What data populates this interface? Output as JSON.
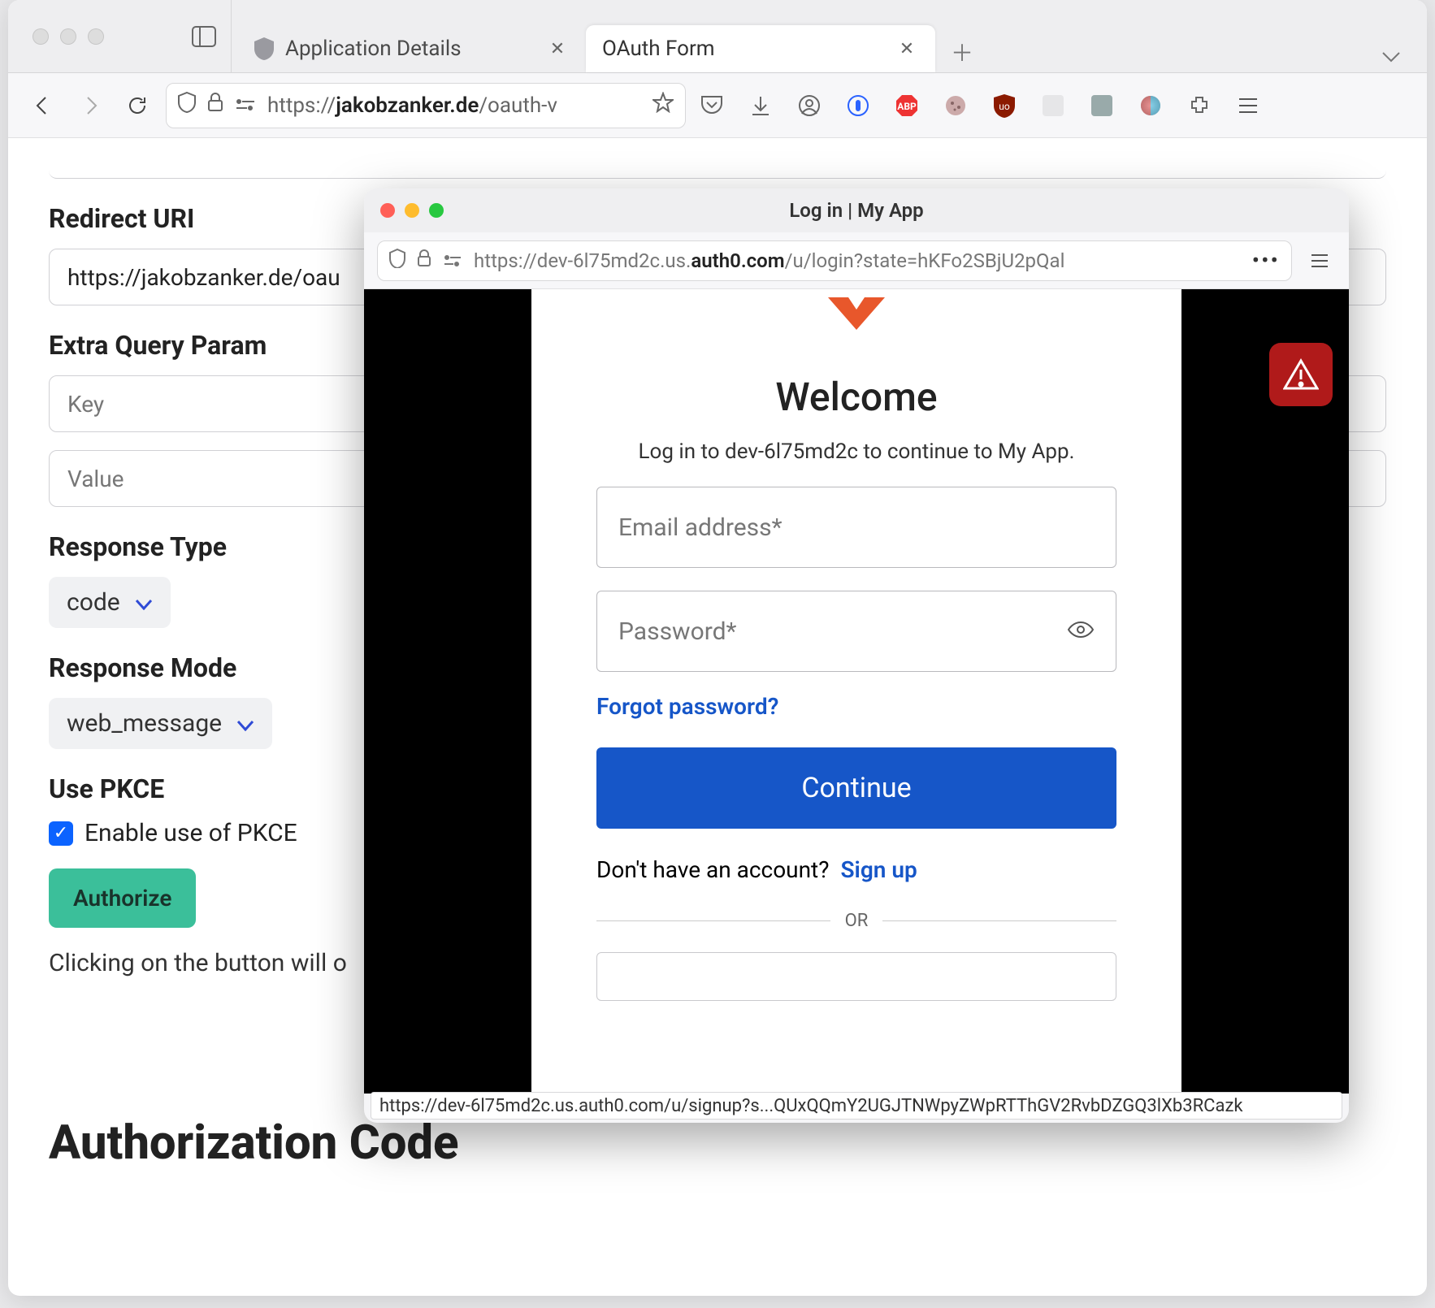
{
  "main_browser": {
    "tabs": [
      {
        "title": "Application Details",
        "active": false
      },
      {
        "title": "OAuth Form",
        "active": true
      }
    ],
    "url_prefix": "https://",
    "url_host": "jakobzanker.de",
    "url_path": "/oauth-v",
    "page": {
      "redirect_uri_label": "Redirect URI",
      "redirect_uri_value": "https://jakobzanker.de/oau",
      "extra_param_label": "Extra Query Param",
      "extra_key_placeholder": "Key",
      "extra_value_placeholder": "Value",
      "response_type_label": "Response Type",
      "response_type_value": "code",
      "response_mode_label": "Response Mode",
      "response_mode_value": "web_message",
      "use_pkce_label": "Use PKCE",
      "pkce_checkbox_label": "Enable use of PKCE",
      "pkce_checked": true,
      "authorize_button": "Authorize",
      "authorize_hint": "Clicking on the button will o",
      "auth_code_heading": "Authorization Code"
    }
  },
  "popup": {
    "title": "Log in | My App",
    "url_prefix": "https://dev-6l75md2c.us.",
    "url_host": "auth0.com",
    "url_path": "/u/login?state=hKFo2SBjU2pQal",
    "welcome": "Welcome",
    "subtitle": "Log in to dev-6l75md2c to continue to My App.",
    "email_placeholder": "Email address*",
    "password_placeholder": "Password*",
    "forgot": "Forgot password?",
    "continue": "Continue",
    "no_account": "Don't have an account?",
    "signup": "Sign up",
    "or": "OR",
    "status_url": "https://dev-6l75md2c.us.auth0.com/u/signup?s...QUxQQmY2UGJTNWpyZWpRTThGV2RvbDZGQ3lXb3RCazk"
  }
}
